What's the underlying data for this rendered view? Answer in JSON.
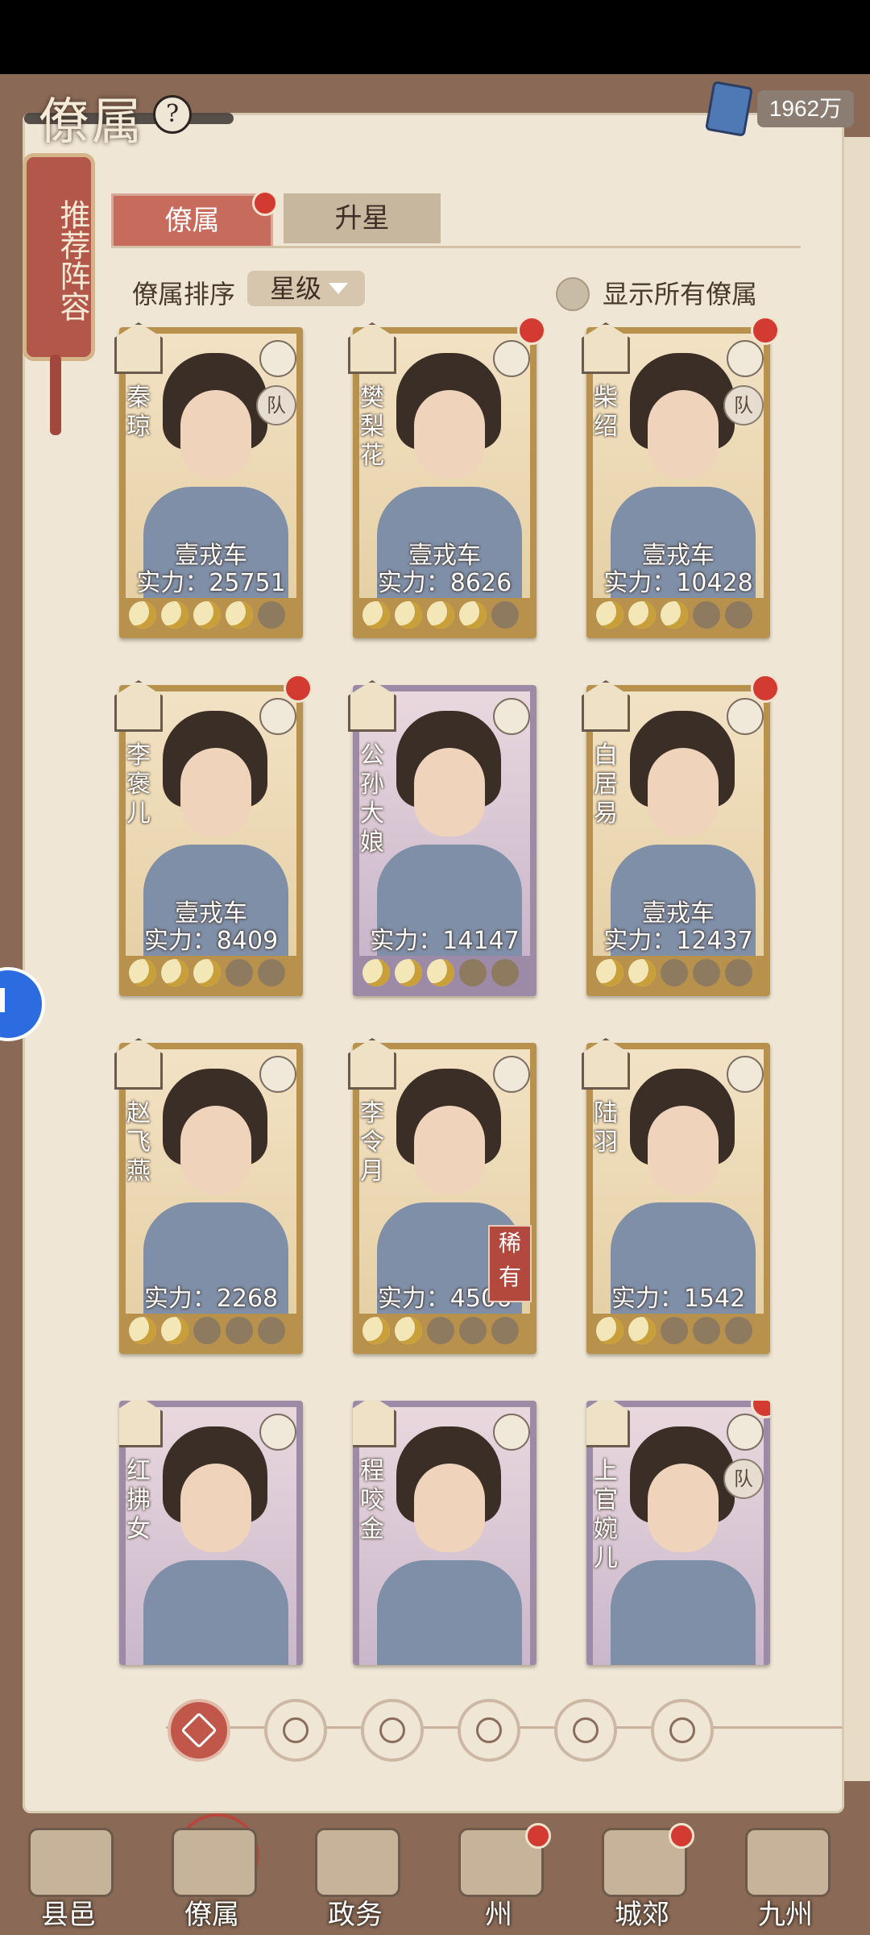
{
  "header": {
    "title": "僚属",
    "help_symbol": "?",
    "silver_value": "1962万"
  },
  "recommend": {
    "label": "推荐阵容"
  },
  "tabs": [
    {
      "label": "僚属",
      "active": true,
      "has_dot": true
    },
    {
      "label": "升星",
      "active": false,
      "has_dot": false
    }
  ],
  "sort": {
    "label": "僚属排序",
    "selected": "星级"
  },
  "toggle": {
    "label": "显示所有僚属",
    "checked": false
  },
  "cards": [
    {
      "name": "秦琼",
      "line1": "壹戎车",
      "power": "实力：25751",
      "stars": 4,
      "max_stars": 6,
      "red_dot": false,
      "team": "队",
      "rarity": "",
      "frame": "gold"
    },
    {
      "name": "樊梨花",
      "line1": "壹戎车",
      "power": "实力：8626",
      "stars": 4,
      "max_stars": 6,
      "red_dot": true,
      "team": "",
      "rarity": "",
      "frame": "gold"
    },
    {
      "name": "柴绍",
      "line1": "壹戎车",
      "power": "实力：10428",
      "stars": 3,
      "max_stars": 6,
      "red_dot": true,
      "team": "队",
      "rarity": "",
      "frame": "gold"
    },
    {
      "name": "李褒儿",
      "line1": "壹戎车",
      "power": "实力：8409",
      "stars": 3,
      "max_stars": 6,
      "red_dot": true,
      "team": "",
      "rarity": "",
      "frame": "gold"
    },
    {
      "name": "公孙大娘",
      "line1": "",
      "power": "实力：14147",
      "stars": 3,
      "max_stars": 6,
      "red_dot": false,
      "team": "",
      "rarity": "",
      "frame": "purple"
    },
    {
      "name": "白居易",
      "line1": "壹戎车",
      "power": "实力：12437",
      "stars": 2,
      "max_stars": 6,
      "red_dot": true,
      "team": "",
      "rarity": "",
      "frame": "gold"
    },
    {
      "name": "赵飞燕",
      "line1": "",
      "power": "实力：2268",
      "stars": 2,
      "max_stars": 6,
      "red_dot": false,
      "team": "",
      "rarity": "",
      "frame": "gold"
    },
    {
      "name": "李令月",
      "line1": "",
      "power": "实力：4506",
      "stars": 2,
      "max_stars": 6,
      "red_dot": false,
      "team": "",
      "rarity": "稀有",
      "frame": "gold"
    },
    {
      "name": "陆羽",
      "line1": "",
      "power": "实力：1542",
      "stars": 2,
      "max_stars": 6,
      "red_dot": false,
      "team": "",
      "rarity": "",
      "frame": "gold"
    },
    {
      "name": "红拂女",
      "line1": "",
      "power": "",
      "stars": 0,
      "max_stars": 6,
      "red_dot": false,
      "team": "",
      "rarity": "",
      "frame": "purple"
    },
    {
      "name": "程咬金",
      "line1": "",
      "power": "",
      "stars": 0,
      "max_stars": 6,
      "red_dot": false,
      "team": "",
      "rarity": "",
      "frame": "purple"
    },
    {
      "name": "上官婉儿",
      "line1": "",
      "power": "",
      "stars": 0,
      "max_stars": 6,
      "red_dot": true,
      "team": "队",
      "rarity": "",
      "frame": "purple"
    }
  ],
  "filters": [
    {
      "icon": "all-diamond-icon",
      "active": true
    },
    {
      "icon": "faction-tower-icon",
      "active": false
    },
    {
      "icon": "faction-gourd-icon",
      "active": false
    },
    {
      "icon": "faction-fan-icon",
      "active": false
    },
    {
      "icon": "faction-horse-icon",
      "active": false
    },
    {
      "icon": "faction-lotus-icon",
      "active": false
    }
  ],
  "nav": [
    {
      "label": "县邑",
      "dot": false
    },
    {
      "label": "僚属",
      "dot": false,
      "active": true
    },
    {
      "label": "政务",
      "dot": false
    },
    {
      "label": "州",
      "dot": true
    },
    {
      "label": "城郊",
      "dot": true
    },
    {
      "label": "九州",
      "dot": false
    }
  ],
  "colors": {
    "accent_red": "#c76c5d",
    "notify_dot": "#d33b32",
    "gold_frame": "#b8924d",
    "purple_frame": "#9c8aa6"
  }
}
